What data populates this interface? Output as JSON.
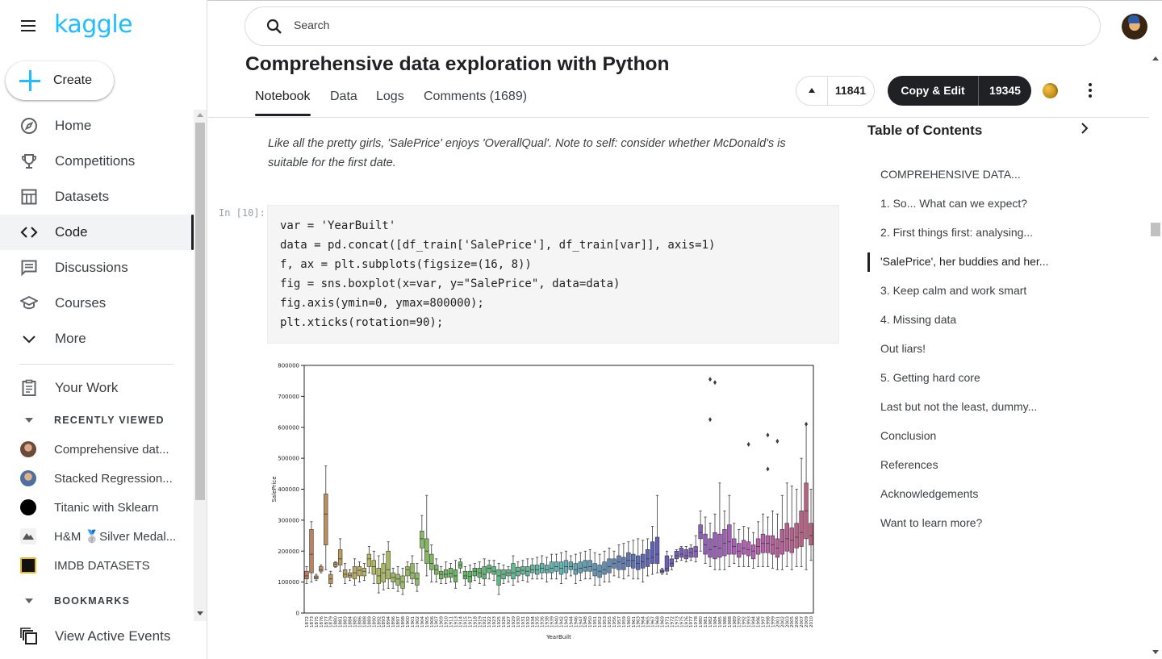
{
  "app": {
    "logo": "kaggle"
  },
  "search": {
    "placeholder": "Search"
  },
  "sidebar": {
    "create_label": "Create",
    "nav": [
      {
        "label": "Home",
        "icon": "compass-icon"
      },
      {
        "label": "Competitions",
        "icon": "trophy-icon"
      },
      {
        "label": "Datasets",
        "icon": "table-icon"
      },
      {
        "label": "Code",
        "icon": "code-icon",
        "active": true
      },
      {
        "label": "Discussions",
        "icon": "comment-icon"
      },
      {
        "label": "Courses",
        "icon": "graduation-cap-icon"
      },
      {
        "label": "More",
        "icon": "chevron-down-icon"
      }
    ],
    "your_work": "Your Work",
    "recently_viewed_label": "RECENTLY VIEWED",
    "recent": [
      {
        "label": "Comprehensive dat..."
      },
      {
        "label": "Stacked Regression..."
      },
      {
        "label": "Titanic with Sklearn"
      },
      {
        "label": "H&M 🥈Silver Medal..."
      },
      {
        "label": "IMDB DATASETS"
      }
    ],
    "bookmarks_label": "BOOKMARKS",
    "view_active_events": "View Active Events"
  },
  "notebook": {
    "title": "Comprehensive data exploration with Python",
    "tabs": [
      "Notebook",
      "Data",
      "Logs",
      "Comments (1689)"
    ],
    "upvotes": "11841",
    "copy_edit_label": "Copy & Edit",
    "copy_edit_count": "19345",
    "markdown": "Like all the pretty girls, 'SalePrice' enjoys 'OverallQual'. Note to self: consider whether McDonald's is suitable for the first date.",
    "in_prompt": "In [10]:",
    "code": [
      "var = 'YearBuilt'",
      "data = pd.concat([df_train['SalePrice'], df_train[var]], axis=1)",
      "f, ax = plt.subplots(figsize=(16, 8))",
      "fig = sns.boxplot(x=var, y=\"SalePrice\", data=data)",
      "fig.axis(ymin=0, ymax=800000);",
      "plt.xticks(rotation=90);"
    ]
  },
  "toc": {
    "title": "Table of Contents",
    "items": [
      "COMPREHENSIVE DATA...",
      "1. So... What can we expect?",
      "2. First things first: analysing...",
      "'SalePrice', her buddies and her...",
      "3. Keep calm and work smart",
      "4. Missing data",
      "Out liars!",
      "5. Getting hard core",
      "Last but not the least, dummy...",
      "Conclusion",
      "References",
      "Acknowledgements",
      "Want to learn more?"
    ],
    "active_index": 3
  },
  "chart_data": {
    "type": "box",
    "xlabel": "YearBuilt",
    "ylabel": "SalePrice",
    "ylim": [
      0,
      800000
    ],
    "yticks": [
      0,
      100000,
      200000,
      300000,
      400000,
      500000,
      600000,
      700000,
      800000
    ],
    "year_range": [
      1872,
      2010
    ],
    "categories_count": 112,
    "series": [
      {
        "q1": 110000,
        "med": 120000,
        "q3": 135000,
        "lo": 95000,
        "hi": 150000
      },
      {
        "q1": 130000,
        "med": 190000,
        "q3": 270000,
        "lo": 100000,
        "hi": 295000
      },
      {
        "q1": 110000,
        "med": 115000,
        "q3": 120000,
        "lo": 105000,
        "hi": 125000
      },
      {
        "q1": 135000,
        "med": 140000,
        "q3": 150000,
        "lo": 130000,
        "hi": 155000
      },
      {
        "q1": 220000,
        "med": 320000,
        "q3": 385000,
        "lo": 140000,
        "hi": 475000
      },
      {
        "q1": 95000,
        "med": 110000,
        "q3": 125000,
        "lo": 85000,
        "hi": 135000
      },
      {
        "q1": 150000,
        "med": 158000,
        "q3": 163000,
        "lo": 148000,
        "hi": 165000
      },
      {
        "q1": 155000,
        "med": 175000,
        "q3": 205000,
        "lo": 135000,
        "hi": 240000
      },
      {
        "q1": 115000,
        "med": 125000,
        "q3": 140000,
        "lo": 95000,
        "hi": 160000
      },
      {
        "q1": 115000,
        "med": 122000,
        "q3": 130000,
        "lo": 105000,
        "hi": 140000
      },
      {
        "q1": 110000,
        "med": 130000,
        "q3": 150000,
        "lo": 90000,
        "hi": 175000
      },
      {
        "q1": 120000,
        "med": 138000,
        "q3": 150000,
        "lo": 100000,
        "hi": 165000
      },
      {
        "q1": 120000,
        "med": 135000,
        "q3": 145000,
        "lo": 105000,
        "hi": 160000
      },
      {
        "q1": 150000,
        "med": 175000,
        "q3": 190000,
        "lo": 130000,
        "hi": 215000
      },
      {
        "q1": 125000,
        "med": 150000,
        "q3": 170000,
        "lo": 95000,
        "hi": 200000
      },
      {
        "q1": 95000,
        "med": 120000,
        "q3": 145000,
        "lo": 65000,
        "hi": 185000
      },
      {
        "q1": 100000,
        "med": 130000,
        "q3": 160000,
        "lo": 75000,
        "hi": 190000
      },
      {
        "q1": 110000,
        "med": 140000,
        "q3": 200000,
        "lo": 80000,
        "hi": 230000
      },
      {
        "q1": 100000,
        "med": 115000,
        "q3": 130000,
        "lo": 80000,
        "hi": 145000
      },
      {
        "q1": 90000,
        "med": 110000,
        "q3": 125000,
        "lo": 70000,
        "hi": 150000
      },
      {
        "q1": 80000,
        "med": 100000,
        "q3": 120000,
        "lo": 60000,
        "hi": 145000
      },
      {
        "q1": 120000,
        "med": 140000,
        "q3": 150000,
        "lo": 100000,
        "hi": 165000
      },
      {
        "q1": 110000,
        "med": 130000,
        "q3": 160000,
        "lo": 95000,
        "hi": 185000
      },
      {
        "q1": 90000,
        "med": 110000,
        "q3": 130000,
        "lo": 70000,
        "hi": 160000
      },
      {
        "q1": 210000,
        "med": 240000,
        "q3": 265000,
        "lo": 170000,
        "hi": 315000
      },
      {
        "q1": 160000,
        "med": 200000,
        "q3": 240000,
        "lo": 120000,
        "hi": 380000
      },
      {
        "q1": 140000,
        "med": 160000,
        "q3": 190000,
        "lo": 100000,
        "hi": 220000
      },
      {
        "q1": 125000,
        "med": 140000,
        "q3": 155000,
        "lo": 100000,
        "hi": 175000
      },
      {
        "q1": 110000,
        "med": 125000,
        "q3": 135000,
        "lo": 95000,
        "hi": 150000
      },
      {
        "q1": 115000,
        "med": 125000,
        "q3": 140000,
        "lo": 95000,
        "hi": 165000
      },
      {
        "q1": 115000,
        "med": 128000,
        "q3": 145000,
        "lo": 100000,
        "hi": 160000
      },
      {
        "q1": 100000,
        "med": 120000,
        "q3": 140000,
        "lo": 80000,
        "hi": 170000
      },
      {
        "q1": 145000,
        "med": 155000,
        "q3": 165000,
        "lo": 130000,
        "hi": 175000
      },
      {
        "q1": 110000,
        "med": 120000,
        "q3": 135000,
        "lo": 90000,
        "hi": 150000
      },
      {
        "q1": 100000,
        "med": 118000,
        "q3": 135000,
        "lo": 80000,
        "hi": 155000
      },
      {
        "q1": 120000,
        "med": 135000,
        "q3": 145000,
        "lo": 105000,
        "hi": 160000
      },
      {
        "q1": 115000,
        "med": 130000,
        "q3": 145000,
        "lo": 95000,
        "hi": 165000
      },
      {
        "q1": 110000,
        "med": 125000,
        "q3": 150000,
        "lo": 90000,
        "hi": 175000
      },
      {
        "q1": 130000,
        "med": 145000,
        "q3": 155000,
        "lo": 110000,
        "hi": 170000
      },
      {
        "q1": 125000,
        "med": 135000,
        "q3": 150000,
        "lo": 105000,
        "hi": 170000
      },
      {
        "q1": 90000,
        "med": 120000,
        "q3": 140000,
        "lo": 60000,
        "hi": 160000
      },
      {
        "q1": 110000,
        "med": 125000,
        "q3": 140000,
        "lo": 95000,
        "hi": 155000
      },
      {
        "q1": 120000,
        "med": 130000,
        "q3": 140000,
        "lo": 100000,
        "hi": 150000
      },
      {
        "q1": 110000,
        "med": 130000,
        "q3": 160000,
        "lo": 90000,
        "hi": 185000
      },
      {
        "q1": 120000,
        "med": 135000,
        "q3": 148000,
        "lo": 100000,
        "hi": 165000
      },
      {
        "q1": 125000,
        "med": 138000,
        "q3": 150000,
        "lo": 105000,
        "hi": 170000
      },
      {
        "q1": 120000,
        "med": 135000,
        "q3": 150000,
        "lo": 100000,
        "hi": 175000
      },
      {
        "q1": 130000,
        "med": 140000,
        "q3": 155000,
        "lo": 110000,
        "hi": 175000
      },
      {
        "q1": 125000,
        "med": 140000,
        "q3": 155000,
        "lo": 110000,
        "hi": 180000
      },
      {
        "q1": 130000,
        "med": 145000,
        "q3": 160000,
        "lo": 110000,
        "hi": 185000
      },
      {
        "q1": 130000,
        "med": 140000,
        "q3": 155000,
        "lo": 100000,
        "hi": 180000
      },
      {
        "q1": 130000,
        "med": 145000,
        "q3": 165000,
        "lo": 110000,
        "hi": 190000
      },
      {
        "q1": 135000,
        "med": 150000,
        "q3": 165000,
        "lo": 110000,
        "hi": 190000
      },
      {
        "q1": 125000,
        "med": 145000,
        "q3": 165000,
        "lo": 95000,
        "hi": 195000
      },
      {
        "q1": 130000,
        "med": 150000,
        "q3": 170000,
        "lo": 110000,
        "hi": 200000
      },
      {
        "q1": 140000,
        "med": 150000,
        "q3": 165000,
        "lo": 120000,
        "hi": 185000
      },
      {
        "q1": 125000,
        "med": 140000,
        "q3": 160000,
        "lo": 95000,
        "hi": 190000
      },
      {
        "q1": 130000,
        "med": 145000,
        "q3": 165000,
        "lo": 105000,
        "hi": 195000
      },
      {
        "q1": 135000,
        "med": 148000,
        "q3": 170000,
        "lo": 110000,
        "hi": 200000
      },
      {
        "q1": 135000,
        "med": 150000,
        "q3": 170000,
        "lo": 110000,
        "hi": 205000
      },
      {
        "q1": 120000,
        "med": 140000,
        "q3": 160000,
        "lo": 90000,
        "hi": 195000
      },
      {
        "q1": 115000,
        "med": 135000,
        "q3": 155000,
        "lo": 90000,
        "hi": 190000
      },
      {
        "q1": 125000,
        "med": 140000,
        "q3": 165000,
        "lo": 100000,
        "hi": 200000
      },
      {
        "q1": 130000,
        "med": 150000,
        "q3": 175000,
        "lo": 100000,
        "hi": 210000
      },
      {
        "q1": 145000,
        "med": 160000,
        "q3": 175000,
        "lo": 120000,
        "hi": 200000
      },
      {
        "q1": 140000,
        "med": 165000,
        "q3": 185000,
        "lo": 115000,
        "hi": 220000
      },
      {
        "q1": 140000,
        "med": 160000,
        "q3": 180000,
        "lo": 110000,
        "hi": 225000
      },
      {
        "q1": 150000,
        "med": 170000,
        "q3": 195000,
        "lo": 120000,
        "hi": 230000
      },
      {
        "q1": 145000,
        "med": 170000,
        "q3": 190000,
        "lo": 110000,
        "hi": 235000
      },
      {
        "q1": 140000,
        "med": 160000,
        "q3": 185000,
        "lo": 110000,
        "hi": 240000
      },
      {
        "q1": 145000,
        "med": 165000,
        "q3": 190000,
        "lo": 100000,
        "hi": 235000
      },
      {
        "q1": 150000,
        "med": 175000,
        "q3": 205000,
        "lo": 120000,
        "hi": 240000
      },
      {
        "q1": 160000,
        "med": 180000,
        "q3": 230000,
        "lo": 125000,
        "hi": 280000
      },
      {
        "q1": 160000,
        "med": 190000,
        "q3": 245000,
        "lo": 130000,
        "hi": 380000
      },
      {
        "q1": 130000,
        "med": 135000,
        "q3": 140000,
        "lo": 125000,
        "hi": 145000
      },
      {
        "q1": 135000,
        "med": 145000,
        "q3": 185000,
        "lo": 125000,
        "hi": 200000
      },
      {
        "q1": 150000,
        "med": 160000,
        "q3": 175000,
        "lo": 140000,
        "hi": 185000
      },
      {
        "q1": 175000,
        "med": 185000,
        "q3": 200000,
        "lo": 165000,
        "hi": 205000
      },
      {
        "q1": 180000,
        "med": 190000,
        "q3": 210000,
        "lo": 170000,
        "hi": 215000
      },
      {
        "q1": 175000,
        "med": 185000,
        "q3": 205000,
        "lo": 165000,
        "hi": 215000
      },
      {
        "q1": 180000,
        "med": 195000,
        "q3": 210000,
        "lo": 170000,
        "hi": 220000
      },
      {
        "q1": 180000,
        "med": 200000,
        "q3": 215000,
        "lo": 165000,
        "hi": 250000
      },
      {
        "q1": 240000,
        "med": 260000,
        "q3": 285000,
        "lo": 200000,
        "hi": 330000
      },
      {
        "q1": 190000,
        "med": 220000,
        "q3": 255000,
        "lo": 160000,
        "hi": 310000
      },
      {
        "q1": 180000,
        "med": 205000,
        "q3": 240000,
        "lo": 150000,
        "hi": 290000
      },
      {
        "q1": 175000,
        "med": 215000,
        "q3": 260000,
        "lo": 140000,
        "hi": 320000
      },
      {
        "q1": 180000,
        "med": 210000,
        "q3": 255000,
        "lo": 140000,
        "hi": 420000
      },
      {
        "q1": 185000,
        "med": 225000,
        "q3": 270000,
        "lo": 140000,
        "hi": 330000
      },
      {
        "q1": 190000,
        "med": 230000,
        "q3": 285000,
        "lo": 150000,
        "hi": 380000
      },
      {
        "q1": 190000,
        "med": 215000,
        "q3": 240000,
        "lo": 160000,
        "hi": 290000
      },
      {
        "q1": 180000,
        "med": 200000,
        "q3": 225000,
        "lo": 150000,
        "hi": 270000
      },
      {
        "q1": 190000,
        "med": 210000,
        "q3": 235000,
        "lo": 150000,
        "hi": 280000
      },
      {
        "q1": 185000,
        "med": 205000,
        "q3": 230000,
        "lo": 150000,
        "hi": 275000
      },
      {
        "q1": 175000,
        "med": 200000,
        "q3": 220000,
        "lo": 145000,
        "hi": 260000
      },
      {
        "q1": 190000,
        "med": 215000,
        "q3": 240000,
        "lo": 150000,
        "hi": 295000
      },
      {
        "q1": 195000,
        "med": 225000,
        "q3": 255000,
        "lo": 150000,
        "hi": 320000
      },
      {
        "q1": 195000,
        "med": 225000,
        "q3": 250000,
        "lo": 150000,
        "hi": 310000
      },
      {
        "q1": 190000,
        "med": 220000,
        "q3": 250000,
        "lo": 145000,
        "hi": 330000
      },
      {
        "q1": 180000,
        "med": 210000,
        "q3": 240000,
        "lo": 140000,
        "hi": 320000
      },
      {
        "q1": 190000,
        "med": 230000,
        "q3": 270000,
        "lo": 140000,
        "hi": 380000
      },
      {
        "q1": 200000,
        "med": 240000,
        "q3": 290000,
        "lo": 150000,
        "hi": 420000
      },
      {
        "q1": 195000,
        "med": 235000,
        "q3": 275000,
        "lo": 140000,
        "hi": 410000
      },
      {
        "q1": 210000,
        "med": 245000,
        "q3": 290000,
        "lo": 150000,
        "hi": 400000
      },
      {
        "q1": 215000,
        "med": 260000,
        "q3": 330000,
        "lo": 150000,
        "hi": 500000
      },
      {
        "q1": 240000,
        "med": 330000,
        "q3": 420000,
        "lo": 140000,
        "hi": 610000
      },
      {
        "q1": 220000,
        "med": 250000,
        "q3": 290000,
        "lo": 170000,
        "hi": 400000
      }
    ],
    "outliers_sample": [
      [
        84,
        755000
      ],
      [
        85,
        745000
      ],
      [
        84,
        625000
      ],
      [
        96,
        575000
      ],
      [
        98,
        555000
      ],
      [
        104,
        610000
      ],
      [
        92,
        545000
      ],
      [
        96,
        465000
      ]
    ]
  }
}
